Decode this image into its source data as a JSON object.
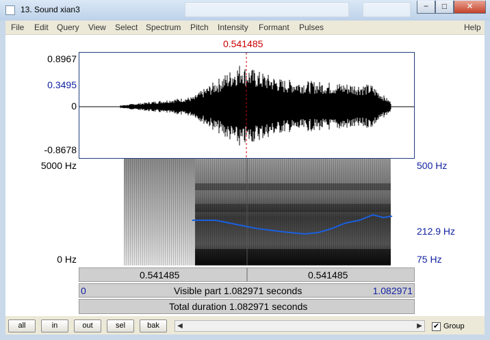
{
  "window": {
    "title": "13. Sound xian3",
    "controls": {
      "minimize": "−",
      "maximize": "□",
      "close": "✕"
    }
  },
  "menu": [
    "File",
    "Edit",
    "Query",
    "View",
    "Select",
    "Spectrum",
    "Pitch",
    "Intensity",
    "Formant",
    "Pulses",
    "Help"
  ],
  "cursor": {
    "time_label": "0.541485",
    "color": "#cc0000"
  },
  "waveform": {
    "y_max": "0.8967",
    "y_mark": "0.3495",
    "y_zero": "0",
    "y_min": "-0.8678"
  },
  "spectrogram": {
    "freq_max": "5000 Hz",
    "freq_min": "0 Hz",
    "pitch_max": "500 Hz",
    "pitch_mark": "212.9 Hz",
    "pitch_min": "75 Hz",
    "pitch_color": "#1a5fe0"
  },
  "time_bars": {
    "left_segment": "0.541485",
    "right_segment": "0.541485",
    "visible_start": "0",
    "visible_text": "Visible part 1.082971 seconds",
    "visible_end": "1.082971",
    "total_text": "Total duration 1.082971 seconds"
  },
  "toolbar": {
    "buttons": [
      "all",
      "in",
      "out",
      "sel",
      "bak"
    ],
    "group_checked": "✔",
    "group_label": "Group"
  }
}
